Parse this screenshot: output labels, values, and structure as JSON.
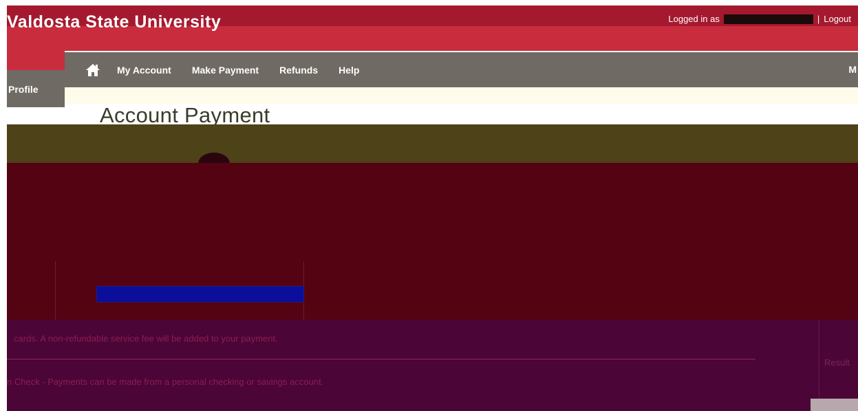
{
  "header": {
    "site_title": "Valdosta State University",
    "logged_in_label": "Logged in as",
    "separator": "|",
    "logout_label": "Logout"
  },
  "nav": {
    "home_icon": "home-icon",
    "items": [
      {
        "label": "My Account"
      },
      {
        "label": "Make Payment"
      },
      {
        "label": "Refunds"
      },
      {
        "label": "Help"
      }
    ],
    "right_fragment": "M"
  },
  "profile_tab": "Profile",
  "page_title": "Account Payment",
  "payment_notes": {
    "card_notice": "cards. A non-refundable service fee will be added to your payment.",
    "echeck_notice": "n Check - Payments can be made from a personal checking or savings account."
  },
  "right_panel": {
    "note": "Result"
  },
  "colors": {
    "banner": "#a5192f",
    "banner_lower": "#c92d3d",
    "nav": "#6f6a63",
    "olive_block": "#4e4218",
    "maroon_block": "#540312",
    "purple_block": "#4b0536",
    "select_blue": "#0a0e9a"
  }
}
